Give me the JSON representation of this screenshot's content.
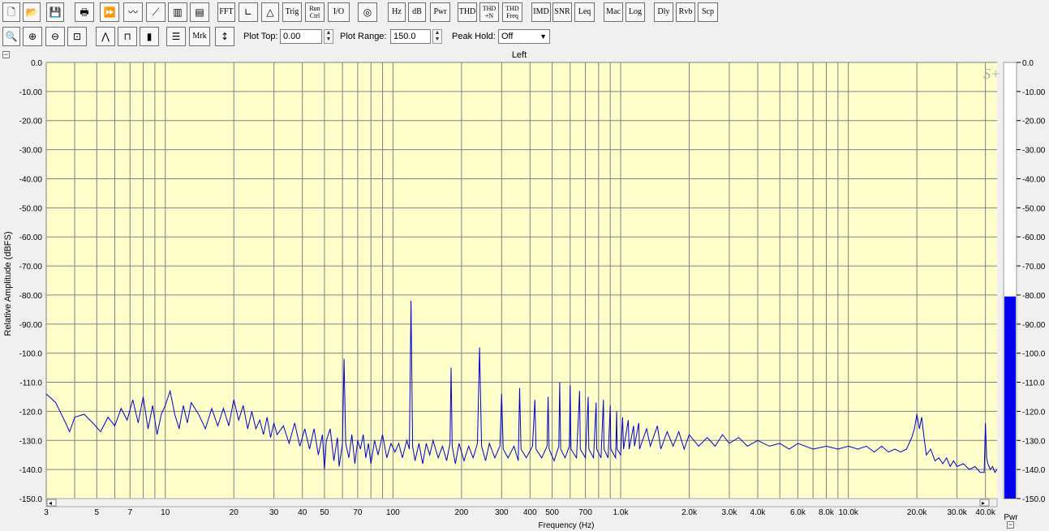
{
  "toolbar1": [
    {
      "name": "new-file-button",
      "label": "",
      "icon": "page-icon"
    },
    {
      "name": "open-file-button",
      "label": "",
      "icon": "folder-icon"
    },
    {
      "name": "save-button",
      "label": "",
      "icon": "floppy-icon"
    },
    {
      "name": "print-button",
      "label": "",
      "icon": "printer-icon"
    },
    {
      "name": "fast-forward-button",
      "label": "",
      "icon": "fast-forward-icon"
    },
    {
      "name": "waveform-zoom-button",
      "label": "",
      "icon": "waveform-icon"
    },
    {
      "name": "sawtooth-button",
      "label": "",
      "icon": "sawtooth-icon"
    },
    {
      "name": "spectrogram-button",
      "label": "",
      "icon": "spectrogram-icon"
    },
    {
      "name": "3d-plot-button",
      "label": "",
      "icon": "waterfall-icon"
    },
    {
      "name": "fft-button",
      "label": "FFT"
    },
    {
      "name": "axis-button",
      "label": "",
      "icon": "axis-icon"
    },
    {
      "name": "triangle-button",
      "label": "",
      "icon": "triangle-icon"
    },
    {
      "name": "trig-button",
      "label": "Trig"
    },
    {
      "name": "run-ctrl-button",
      "label": "Run Ctrl",
      "stack": [
        "Run",
        "Ctrl"
      ]
    },
    {
      "name": "io-button",
      "label": "I/O"
    },
    {
      "name": "generator-button",
      "label": "",
      "icon": "sine-circle-icon"
    },
    {
      "name": "hz-button",
      "label": "Hz"
    },
    {
      "name": "db-button",
      "label": "dB"
    },
    {
      "name": "pwr-button",
      "label": "Pwr"
    },
    {
      "name": "thd-button",
      "label": "THD"
    },
    {
      "name": "thd-n-button",
      "label": "THD +N",
      "stack": [
        "THD",
        "+N"
      ]
    },
    {
      "name": "thd-freq-button",
      "label": "THD Freq",
      "stack": [
        "THD",
        "Freq"
      ]
    },
    {
      "name": "imd-button",
      "label": "IMD"
    },
    {
      "name": "snr-button",
      "label": "SNR"
    },
    {
      "name": "leq-button",
      "label": "Leq"
    },
    {
      "name": "mac-button",
      "label": "Mac"
    },
    {
      "name": "log-button",
      "label": "Log"
    },
    {
      "name": "dly-button",
      "label": "Dly"
    },
    {
      "name": "rvb-button",
      "label": "Rvb"
    },
    {
      "name": "scp-button",
      "label": "Scp"
    }
  ],
  "toolbar2": {
    "zoom_buttons": [
      {
        "name": "zoom-button",
        "icon": "magnifier-icon"
      },
      {
        "name": "zoom-in-2x-button",
        "icon": "zoom-in-icon"
      },
      {
        "name": "zoom-out-2x-button",
        "icon": "zoom-out-icon"
      },
      {
        "name": "zoom-full-button",
        "icon": "zoom-full-icon"
      },
      {
        "name": "line-plot-button",
        "icon": "line-plot-icon"
      },
      {
        "name": "step-plot-button",
        "icon": "step-plot-icon"
      },
      {
        "name": "bar-plot-button",
        "icon": "bar-plot-icon"
      },
      {
        "name": "markers-list-button",
        "icon": "list-icon"
      },
      {
        "name": "marker-button",
        "label": "Mrk"
      },
      {
        "name": "range-button",
        "icon": "vertical-range-icon"
      }
    ],
    "plot_top_label": "Plot Top:",
    "plot_top_value": "0.00",
    "plot_range_label": "Plot Range:",
    "plot_range_value": "150.0",
    "peak_hold_label": "Peak Hold:",
    "peak_hold_value": "Off"
  },
  "colors": {
    "plot_bg": "#ffffcc",
    "trace": "#0000cc",
    "meter_bar": "#0000ee",
    "grid": "#808080"
  },
  "logo": "S+",
  "meter": {
    "label": "Pwr",
    "level_db": -80.5,
    "ticks": [
      "0.0",
      "-10.00",
      "-20.00",
      "-30.00",
      "-40.00",
      "-50.00",
      "-60.00",
      "-70.00",
      "-80.00",
      "-90.00",
      "-100.0",
      "-110.0",
      "-120.0",
      "-130.0",
      "-140.0",
      "-150.0"
    ]
  },
  "chart_data": {
    "type": "line",
    "title": "Left",
    "xlabel": "Frequency (Hz)",
    "ylabel": "Relative Amplitude (dBFS)",
    "xscale": "log",
    "xlim": [
      3,
      45000
    ],
    "ylim": [
      -150,
      0
    ],
    "grid": true,
    "y_ticks": [
      "0.0",
      "-10.00",
      "-20.00",
      "-30.00",
      "-40.00",
      "-50.00",
      "-60.00",
      "-70.00",
      "-80.00",
      "-90.00",
      "-100.0",
      "-110.0",
      "-120.0",
      "-130.0",
      "-140.0",
      "-150.0"
    ],
    "x_ticks": [
      {
        "v": 3,
        "label": "3"
      },
      {
        "v": 5,
        "label": "5"
      },
      {
        "v": 7,
        "label": "7"
      },
      {
        "v": 10,
        "label": "10"
      },
      {
        "v": 20,
        "label": "20"
      },
      {
        "v": 30,
        "label": "30"
      },
      {
        "v": 40,
        "label": "40"
      },
      {
        "v": 50,
        "label": "50"
      },
      {
        "v": 70,
        "label": "70"
      },
      {
        "v": 100,
        "label": "100"
      },
      {
        "v": 200,
        "label": "200"
      },
      {
        "v": 300,
        "label": "300"
      },
      {
        "v": 400,
        "label": "400"
      },
      {
        "v": 500,
        "label": "500"
      },
      {
        "v": 700,
        "label": "700"
      },
      {
        "v": 1000,
        "label": "1.0k"
      },
      {
        "v": 2000,
        "label": "2.0k"
      },
      {
        "v": 3000,
        "label": "3.0k"
      },
      {
        "v": 4000,
        "label": "4.0k"
      },
      {
        "v": 6000,
        "label": "6.0k"
      },
      {
        "v": 8000,
        "label": "8.0k"
      },
      {
        "v": 10000,
        "label": "10.0k"
      },
      {
        "v": 20000,
        "label": "20.0k"
      },
      {
        "v": 30000,
        "label": "30.0k"
      },
      {
        "v": 40000,
        "label": "40.0k"
      }
    ],
    "series": [
      {
        "points": [
          [
            3,
            -114
          ],
          [
            3.3,
            -117
          ],
          [
            3.6,
            -123
          ],
          [
            3.8,
            -127
          ],
          [
            4.0,
            -122
          ],
          [
            4.4,
            -121
          ],
          [
            4.8,
            -124
          ],
          [
            5.2,
            -127
          ],
          [
            5.6,
            -122
          ],
          [
            6.0,
            -125
          ],
          [
            6.4,
            -119
          ],
          [
            6.8,
            -123
          ],
          [
            7.2,
            -116
          ],
          [
            7.6,
            -124
          ],
          [
            8.0,
            -115
          ],
          [
            8.4,
            -126
          ],
          [
            8.8,
            -118
          ],
          [
            9.2,
            -128
          ],
          [
            9.6,
            -121
          ],
          [
            10.0,
            -118
          ],
          [
            10.5,
            -113
          ],
          [
            11,
            -121
          ],
          [
            11.5,
            -126
          ],
          [
            12,
            -118
          ],
          [
            12.5,
            -124
          ],
          [
            13,
            -117
          ],
          [
            14,
            -121
          ],
          [
            15,
            -126
          ],
          [
            16,
            -119
          ],
          [
            17,
            -125
          ],
          [
            18,
            -119
          ],
          [
            19,
            -125
          ],
          [
            20,
            -116
          ],
          [
            21,
            -123
          ],
          [
            22,
            -118
          ],
          [
            23,
            -126
          ],
          [
            24,
            -120
          ],
          [
            25,
            -126
          ],
          [
            26,
            -123
          ],
          [
            27,
            -128
          ],
          [
            28,
            -122
          ],
          [
            29,
            -129
          ],
          [
            30,
            -124
          ],
          [
            31,
            -128
          ],
          [
            33,
            -125
          ],
          [
            35,
            -131
          ],
          [
            37,
            -124
          ],
          [
            39,
            -132
          ],
          [
            41,
            -126
          ],
          [
            43,
            -133
          ],
          [
            45,
            -126
          ],
          [
            47,
            -135
          ],
          [
            49,
            -128
          ],
          [
            50,
            -140
          ],
          [
            51,
            -130
          ],
          [
            53,
            -126
          ],
          [
            55,
            -137
          ],
          [
            57,
            -129
          ],
          [
            58,
            -139
          ],
          [
            60,
            -131
          ],
          [
            61,
            -102
          ],
          [
            62,
            -131
          ],
          [
            64,
            -136
          ],
          [
            66,
            -128
          ],
          [
            68,
            -138
          ],
          [
            70,
            -130
          ],
          [
            72,
            -133
          ],
          [
            74,
            -128
          ],
          [
            76,
            -136
          ],
          [
            78,
            -131
          ],
          [
            80,
            -138
          ],
          [
            83,
            -130
          ],
          [
            86,
            -135
          ],
          [
            90,
            -128
          ],
          [
            94,
            -136
          ],
          [
            98,
            -131
          ],
          [
            102,
            -134
          ],
          [
            106,
            -131
          ],
          [
            110,
            -136
          ],
          [
            115,
            -130
          ],
          [
            118,
            -133
          ],
          [
            120,
            -82
          ],
          [
            122,
            -132
          ],
          [
            125,
            -137
          ],
          [
            130,
            -131
          ],
          [
            135,
            -138
          ],
          [
            140,
            -131
          ],
          [
            145,
            -135
          ],
          [
            150,
            -130
          ],
          [
            158,
            -136
          ],
          [
            165,
            -132
          ],
          [
            172,
            -137
          ],
          [
            178,
            -131
          ],
          [
            180,
            -105
          ],
          [
            182,
            -132
          ],
          [
            188,
            -138
          ],
          [
            195,
            -131
          ],
          [
            205,
            -137
          ],
          [
            215,
            -132
          ],
          [
            225,
            -136
          ],
          [
            235,
            -131
          ],
          [
            240,
            -98
          ],
          [
            245,
            -132
          ],
          [
            255,
            -137
          ],
          [
            265,
            -131
          ],
          [
            280,
            -136
          ],
          [
            295,
            -132
          ],
          [
            300,
            -114
          ],
          [
            305,
            -133
          ],
          [
            320,
            -136
          ],
          [
            340,
            -132
          ],
          [
            355,
            -137
          ],
          [
            360,
            -112
          ],
          [
            365,
            -133
          ],
          [
            385,
            -136
          ],
          [
            410,
            -132
          ],
          [
            420,
            -116
          ],
          [
            425,
            -133
          ],
          [
            450,
            -136
          ],
          [
            475,
            -132
          ],
          [
            480,
            -115
          ],
          [
            485,
            -133
          ],
          [
            510,
            -137
          ],
          [
            535,
            -132
          ],
          [
            540,
            -110
          ],
          [
            545,
            -133
          ],
          [
            570,
            -136
          ],
          [
            595,
            -132
          ],
          [
            600,
            -111
          ],
          [
            605,
            -133
          ],
          [
            640,
            -136
          ],
          [
            660,
            -113
          ],
          [
            665,
            -133
          ],
          [
            700,
            -136
          ],
          [
            720,
            -115
          ],
          [
            725,
            -133
          ],
          [
            760,
            -136
          ],
          [
            780,
            -117
          ],
          [
            785,
            -133
          ],
          [
            820,
            -136
          ],
          [
            840,
            -116
          ],
          [
            845,
            -133
          ],
          [
            880,
            -136
          ],
          [
            900,
            -118
          ],
          [
            905,
            -133
          ],
          [
            950,
            -136
          ],
          [
            960,
            -120
          ],
          [
            965,
            -133
          ],
          [
            1000,
            -135
          ],
          [
            1020,
            -122
          ],
          [
            1030,
            -133
          ],
          [
            1080,
            -123
          ],
          [
            1090,
            -133
          ],
          [
            1140,
            -125
          ],
          [
            1150,
            -132
          ],
          [
            1200,
            -124
          ],
          [
            1210,
            -133
          ],
          [
            1300,
            -126
          ],
          [
            1350,
            -132
          ],
          [
            1450,
            -125
          ],
          [
            1500,
            -133
          ],
          [
            1600,
            -127
          ],
          [
            1700,
            -132
          ],
          [
            1800,
            -127
          ],
          [
            1900,
            -133
          ],
          [
            2000,
            -128
          ],
          [
            2200,
            -132
          ],
          [
            2400,
            -129
          ],
          [
            2600,
            -132
          ],
          [
            2800,
            -128
          ],
          [
            3000,
            -131
          ],
          [
            3300,
            -129
          ],
          [
            3600,
            -132
          ],
          [
            4000,
            -130
          ],
          [
            4500,
            -132
          ],
          [
            5000,
            -131
          ],
          [
            5500,
            -133
          ],
          [
            6000,
            -131
          ],
          [
            7000,
            -133
          ],
          [
            8000,
            -132
          ],
          [
            9000,
            -133
          ],
          [
            10000,
            -132
          ],
          [
            11000,
            -133
          ],
          [
            12000,
            -132
          ],
          [
            13000,
            -134
          ],
          [
            14000,
            -132
          ],
          [
            15000,
            -134
          ],
          [
            16000,
            -133
          ],
          [
            17000,
            -134
          ],
          [
            18000,
            -133
          ],
          [
            19000,
            -129
          ],
          [
            19500,
            -126
          ],
          [
            20000,
            -121
          ],
          [
            20500,
            -126
          ],
          [
            21000,
            -122
          ],
          [
            21500,
            -129
          ],
          [
            22000,
            -135
          ],
          [
            23000,
            -133
          ],
          [
            24000,
            -137
          ],
          [
            25000,
            -136
          ],
          [
            26000,
            -138
          ],
          [
            27000,
            -136
          ],
          [
            28000,
            -139
          ],
          [
            29000,
            -137
          ],
          [
            30000,
            -139
          ],
          [
            32000,
            -138
          ],
          [
            34000,
            -140
          ],
          [
            36000,
            -139
          ],
          [
            38000,
            -141
          ],
          [
            39500,
            -141
          ],
          [
            40000,
            -124
          ],
          [
            40500,
            -136
          ],
          [
            41000,
            -138
          ],
          [
            42000,
            -140
          ],
          [
            43000,
            -139
          ],
          [
            44000,
            -141
          ],
          [
            45000,
            -140
          ]
        ]
      }
    ]
  }
}
